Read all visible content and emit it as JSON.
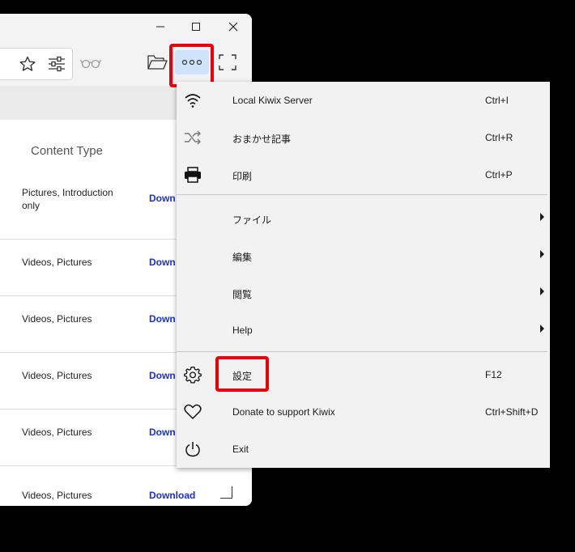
{
  "window": {
    "minimize_icon": "minimize-icon",
    "maximize_icon": "maximize-icon",
    "close_icon": "close-icon"
  },
  "toolbar": {
    "icons": [
      "star-icon",
      "sliders-icon",
      "reading-glasses-icon",
      "folder-open-icon",
      "more-horizontal-icon",
      "fullscreen-icon"
    ]
  },
  "library": {
    "column_header": "Content Type",
    "rows": [
      {
        "content_type": "Pictures, Introduction only",
        "action": "Down"
      },
      {
        "content_type": "Videos, Pictures",
        "action": "Down"
      },
      {
        "content_type": "Videos, Pictures",
        "action": "Down"
      },
      {
        "content_type": "Videos, Pictures",
        "action": "Down"
      },
      {
        "content_type": "Videos, Pictures",
        "action": "Down"
      },
      {
        "content_type": "Videos, Pictures",
        "action": "Download"
      }
    ]
  },
  "menu": {
    "items": [
      {
        "label": "Local Kiwix Server",
        "shortcut": "Ctrl+I",
        "icon": "wifi-icon"
      },
      {
        "label": "おまかせ記事",
        "shortcut": "Ctrl+R",
        "icon": "shuffle-icon"
      },
      {
        "label": "印刷",
        "shortcut": "Ctrl+P",
        "icon": "printer-icon"
      },
      {
        "label": "ファイル",
        "shortcut": "",
        "submenu": true
      },
      {
        "label": "編集",
        "shortcut": "",
        "submenu": true
      },
      {
        "label": "閲覧",
        "shortcut": "",
        "submenu": true
      },
      {
        "label": "Help",
        "shortcut": "",
        "submenu": true
      },
      {
        "label": "設定",
        "shortcut": "F12",
        "icon": "gear-icon"
      },
      {
        "label": "Donate to support Kiwix",
        "shortcut": "Ctrl+Shift+D",
        "icon": "heart-icon"
      },
      {
        "label": "Exit",
        "shortcut": "",
        "icon": "power-icon"
      }
    ]
  },
  "colors": {
    "highlight": "#e8000b",
    "download_link": "#1a2fd6",
    "menu_bg": "#f2f2f2"
  }
}
